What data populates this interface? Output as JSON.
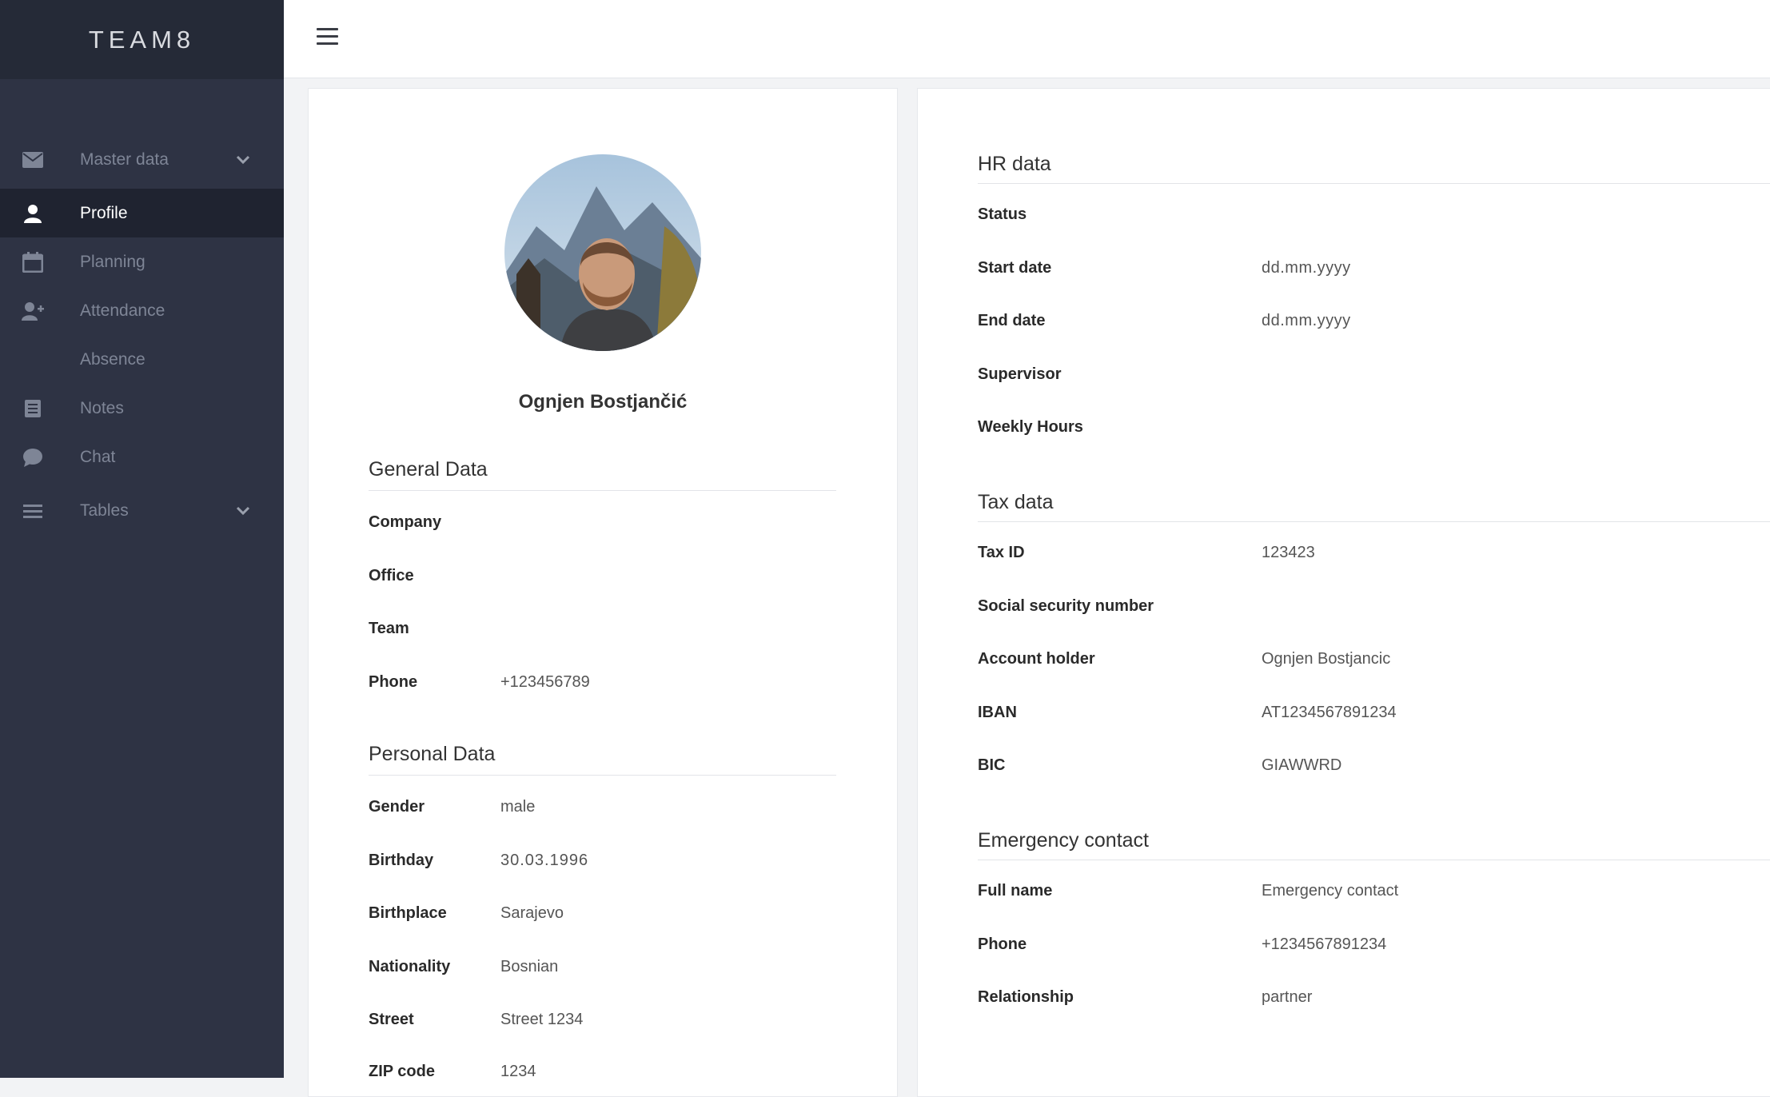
{
  "brand": "TEAM8",
  "sidebar": {
    "items": [
      {
        "label": "Master data",
        "icon": "envelope-icon"
      },
      {
        "label": "Profile",
        "icon": "user-icon"
      },
      {
        "label": "Planning",
        "icon": "calendar-icon"
      },
      {
        "label": "Attendance",
        "icon": "user-plus-icon"
      },
      {
        "label": "Absence",
        "icon": ""
      },
      {
        "label": "Notes",
        "icon": "notes-icon"
      },
      {
        "label": "Chat",
        "icon": "chat-bubble-icon"
      },
      {
        "label": "Tables",
        "icon": "list-icon"
      }
    ]
  },
  "profile": {
    "name": "Ognjen Bostjančić",
    "general": {
      "title": "General Data",
      "rows": [
        {
          "label": "Company",
          "value": ""
        },
        {
          "label": "Office",
          "value": ""
        },
        {
          "label": "Team",
          "value": ""
        },
        {
          "label": "Phone",
          "value": "+123456789"
        }
      ]
    },
    "personal": {
      "title": "Personal Data",
      "rows": [
        {
          "label": "Gender",
          "value": "male"
        },
        {
          "label": "Birthday",
          "value": "30.03.1996"
        },
        {
          "label": "Birthplace",
          "value": "Sarajevo"
        },
        {
          "label": "Nationality",
          "value": "Bosnian"
        },
        {
          "label": "Street",
          "value": "Street 1234"
        },
        {
          "label": "ZIP code",
          "value": "1234"
        }
      ]
    }
  },
  "hr": {
    "title": "HR data",
    "rows": [
      {
        "label": "Status",
        "value": ""
      },
      {
        "label": "Start date",
        "value": "dd.mm.yyyy"
      },
      {
        "label": "End date",
        "value": "dd.mm.yyyy"
      },
      {
        "label": "Supervisor",
        "value": ""
      },
      {
        "label": "Weekly Hours",
        "value": ""
      }
    ]
  },
  "tax": {
    "title": "Tax data",
    "rows": [
      {
        "label": "Tax ID",
        "value": "123423"
      },
      {
        "label": "Social security number",
        "value": ""
      },
      {
        "label": "Account holder",
        "value": "Ognjen Bostjancic"
      },
      {
        "label": "IBAN",
        "value": "AT1234567891234"
      },
      {
        "label": "BIC",
        "value": "GIAWWRD"
      }
    ]
  },
  "emergency": {
    "title": "Emergency contact",
    "rows": [
      {
        "label": "Full name",
        "value": "Emergency contact"
      },
      {
        "label": "Phone",
        "value": "+1234567891234"
      },
      {
        "label": "Relationship",
        "value": "partner"
      }
    ]
  }
}
